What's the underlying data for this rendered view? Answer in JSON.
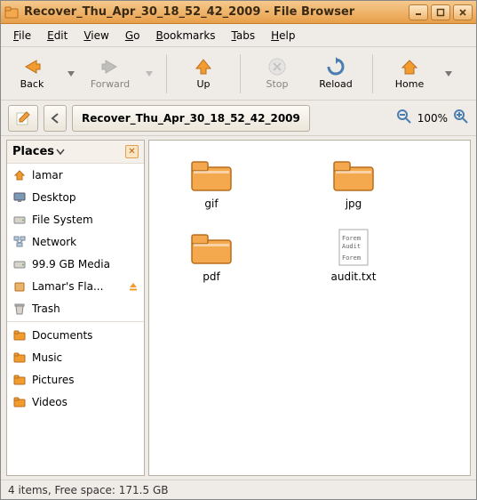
{
  "window": {
    "title": "Recover_Thu_Apr_30_18_52_42_2009 - File Browser"
  },
  "menu": {
    "file": "File",
    "edit": "Edit",
    "view": "View",
    "go": "Go",
    "bookmarks": "Bookmarks",
    "tabs": "Tabs",
    "help": "Help"
  },
  "toolbar": {
    "back": "Back",
    "forward": "Forward",
    "up": "Up",
    "stop": "Stop",
    "reload": "Reload",
    "home": "Home"
  },
  "location": {
    "path_label": "Recover_Thu_Apr_30_18_52_42_2009",
    "zoom_text": "100%"
  },
  "sidebar": {
    "header": "Places",
    "items": [
      {
        "label": "lamar",
        "icon": "home",
        "eject": false
      },
      {
        "label": "Desktop",
        "icon": "desktop",
        "eject": false
      },
      {
        "label": "File System",
        "icon": "drive",
        "eject": false
      },
      {
        "label": "Network",
        "icon": "network",
        "eject": false
      },
      {
        "label": "99.9 GB Media",
        "icon": "drive",
        "eject": false
      },
      {
        "label": "Lamar's Fla...",
        "icon": "removable",
        "eject": true
      },
      {
        "label": "Trash",
        "icon": "trash",
        "eject": false
      }
    ],
    "bookmarks": [
      {
        "label": "Documents"
      },
      {
        "label": "Music"
      },
      {
        "label": "Pictures"
      },
      {
        "label": "Videos"
      }
    ]
  },
  "files": {
    "items": [
      {
        "name": "gif",
        "type": "folder"
      },
      {
        "name": "jpg",
        "type": "folder"
      },
      {
        "name": "pdf",
        "type": "folder"
      },
      {
        "name": "audit.txt",
        "type": "text"
      }
    ]
  },
  "status": {
    "text": "4 items, Free space: 171.5 GB"
  }
}
